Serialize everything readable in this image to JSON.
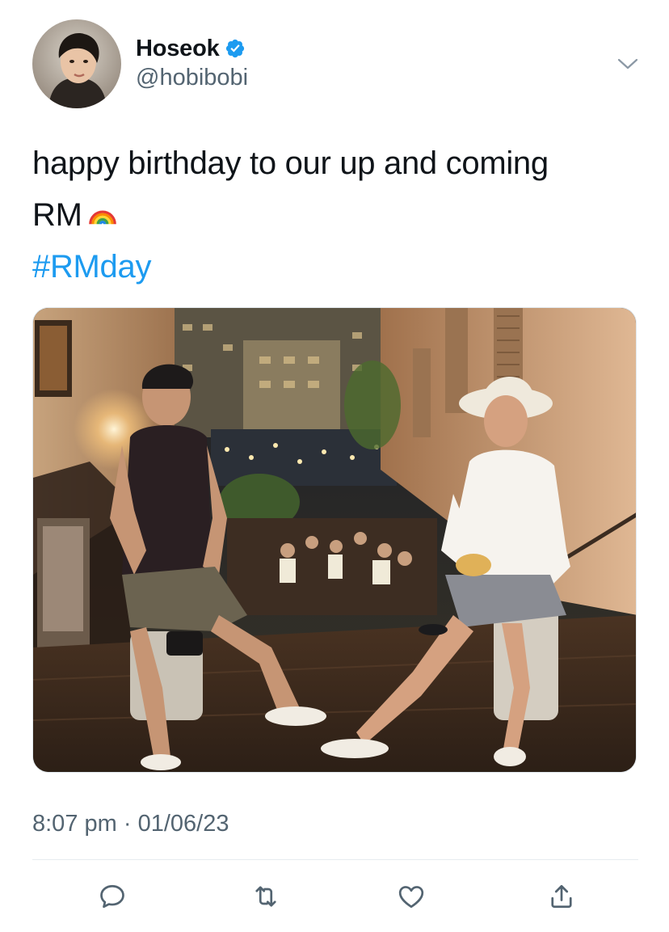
{
  "author": {
    "display_name": "Hoseok",
    "handle": "@hobibobi",
    "verified": true,
    "verified_color": "#1d9bf0"
  },
  "tweet": {
    "text_line1": "happy birthday to our up and coming",
    "text_line2": "RM",
    "emoji": "rainbow",
    "hashtag": "#RMday",
    "hashtag_color": "#1d9bf0"
  },
  "meta": {
    "time": "8:07 pm",
    "separator": "·",
    "date": "01/06/23"
  },
  "actions": [
    {
      "icon": "reply-icon"
    },
    {
      "icon": "retweet-icon"
    },
    {
      "icon": "like-icon"
    },
    {
      "icon": "share-icon"
    }
  ],
  "colors": {
    "text": "#0f1419",
    "secondary": "#536471",
    "accent": "#1d9bf0"
  }
}
